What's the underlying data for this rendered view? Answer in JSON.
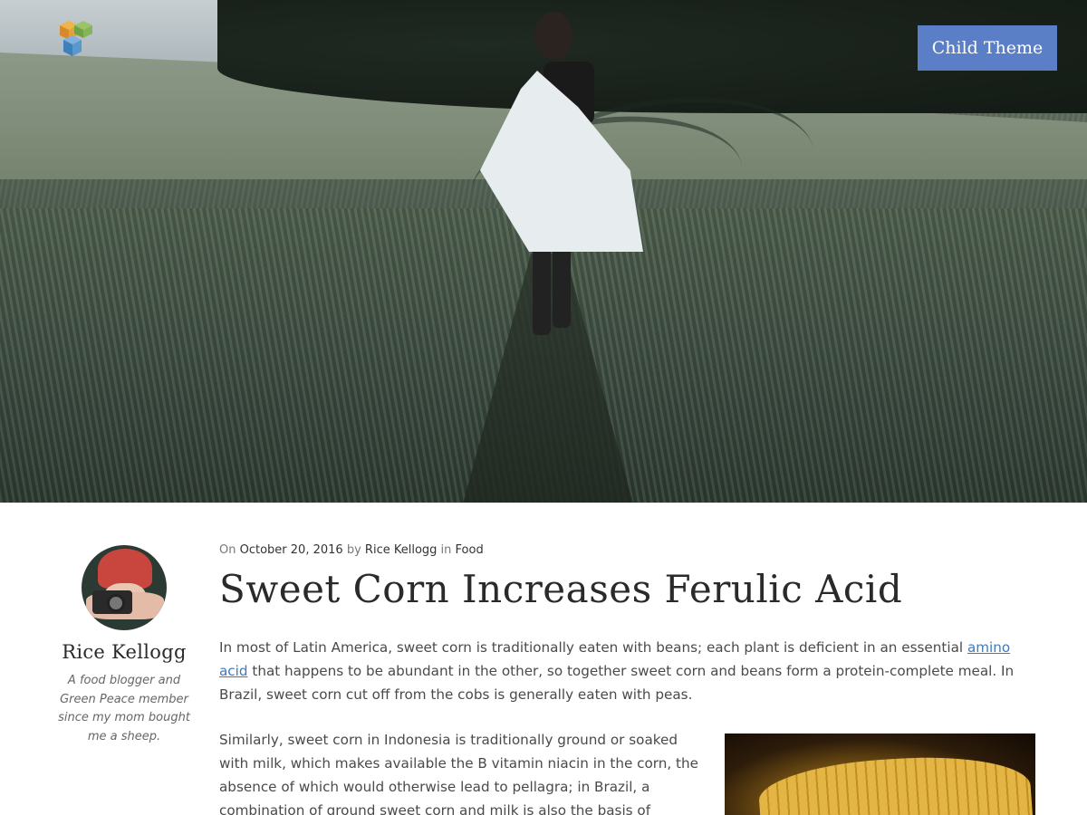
{
  "header": {
    "theme_button_label": "Child Theme",
    "logo_icon": "visual-composer-cubes-icon",
    "hero_image": "woman-walking-in-wheat-field"
  },
  "author": {
    "avatar_image": "woman-with-red-hat-and-camera",
    "name": "Rice Kellogg",
    "bio": "A food blogger and Green Peace member since my mom bought me a sheep."
  },
  "post": {
    "meta": {
      "on_label": "On",
      "date": "October 20, 2016",
      "by_label": "by",
      "author": "Rice Kellogg",
      "in_label": "in",
      "category": "Food"
    },
    "title": "Sweet Corn Increases Ferulic Acid",
    "paragraph1": {
      "before_link": "In most of Latin America, sweet corn is traditionally eaten with beans; each plant is deficient in an essential ",
      "link_text": "amino acid",
      "after_link": " that happens to be abundant in the other, so together sweet corn and beans form a protein-complete meal. In Brazil, sweet corn cut off from the cobs is generally eaten with peas."
    },
    "paragraph2": "Similarly, sweet corn in Indonesia is traditionally ground or soaked with milk, which makes available the B vitamin niacin in the corn, the absence of which would otherwise lead to pellagra; in Brazil, a combination of ground sweet corn and milk is also the basis of various well-known dishes, such as",
    "inline_image": "grilled-corn-cob"
  },
  "colors": {
    "accent_button": "#5a7fc6",
    "link": "#3c7bbf",
    "heading": "#2a2a2a"
  }
}
